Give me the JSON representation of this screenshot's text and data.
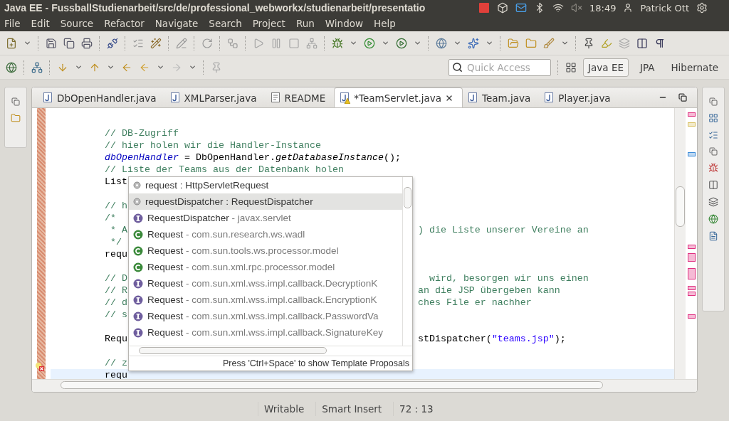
{
  "top_panel": {
    "title": "Java EE - FussballStudienarbeit/src/de/professional_webworkx/studienarbeit/presentatio",
    "time": "18:49",
    "user": "Patrick Ott"
  },
  "menu": [
    "File",
    "Edit",
    "Source",
    "Refactor",
    "Navigate",
    "Search",
    "Project",
    "Run",
    "Window",
    "Help"
  ],
  "quick_access": {
    "placeholder": "Quick Access"
  },
  "perspectives": [
    {
      "label": "Java EE",
      "selected": true
    },
    {
      "label": "JPA",
      "selected": false
    },
    {
      "label": "Hibernate",
      "selected": false
    }
  ],
  "tabs": [
    {
      "label": "DbOpenHandler.java",
      "kind": "java",
      "warning": false,
      "selected": false
    },
    {
      "label": "XMLParser.java",
      "kind": "java",
      "warning": false,
      "selected": false
    },
    {
      "label": "README",
      "kind": "text",
      "warning": false,
      "selected": false
    },
    {
      "label": "*TeamServlet.java",
      "kind": "java",
      "warning": true,
      "selected": true
    },
    {
      "label": "Team.java",
      "kind": "java",
      "warning": false,
      "selected": false
    },
    {
      "label": "Player.java",
      "kind": "java",
      "warning": false,
      "selected": false
    }
  ],
  "code_lines": [
    {
      "kind": "code",
      "current": false,
      "parts": [
        {
          "text": "// DB-Zugriff",
          "kind": "comment"
        }
      ]
    },
    {
      "kind": "code",
      "current": false,
      "parts": [
        {
          "text": "// hier holen wir die Handler-Instance",
          "kind": "comment"
        }
      ]
    },
    {
      "kind": "code",
      "current": false,
      "parts": [
        {
          "text": "dbOpenHandler",
          "kind": "field"
        },
        {
          "text": " = DbOpenHandler.",
          "kind": "plain"
        },
        {
          "text": "getDatabaseInstance",
          "kind": "static"
        },
        {
          "text": "();",
          "kind": "plain"
        }
      ]
    },
    {
      "kind": "code",
      "current": false,
      "parts": [
        {
          "text": "// Liste der Teams aus der Datenbank holen",
          "kind": "comment"
        }
      ]
    },
    {
      "kind": "code",
      "current": false,
      "parts": [
        {
          "text": "List",
          "kind": "plain"
        }
      ]
    },
    {
      "kind": "blank",
      "current": false
    },
    {
      "kind": "code",
      "current": false,
      "parts": [
        {
          "text": "// h",
          "kind": "comment"
        }
      ]
    },
    {
      "kind": "code",
      "current": false,
      "parts": [
        {
          "text": "/*",
          "kind": "comment"
        }
      ]
    },
    {
      "kind": "code",
      "current": false,
      "parts": [
        {
          "text": " * A",
          "kind": "comment"
        }
      ],
      "right": [
        {
          "text": ") die Liste unserer Vereine an",
          "kind": "comment"
        }
      ]
    },
    {
      "kind": "code",
      "current": false,
      "parts": [
        {
          "text": " */",
          "kind": "comment"
        }
      ]
    },
    {
      "kind": "code",
      "current": false,
      "parts": [
        {
          "text": "requ",
          "kind": "plain"
        }
      ]
    },
    {
      "kind": "blank",
      "current": false
    },
    {
      "kind": "code",
      "current": false,
      "parts": [
        {
          "text": "// D",
          "kind": "comment"
        }
      ],
      "right": [
        {
          "text": "  wird, besorgen wir uns einen",
          "kind": "comment"
        }
      ]
    },
    {
      "kind": "code",
      "current": false,
      "parts": [
        {
          "text": "// R",
          "kind": "comment"
        }
      ],
      "right": [
        {
          "text": "an die JSP übergeben kann",
          "kind": "comment"
        }
      ]
    },
    {
      "kind": "code",
      "current": false,
      "parts": [
        {
          "text": "// d",
          "kind": "comment"
        }
      ],
      "right": [
        {
          "text": "ches File er nachher",
          "kind": "comment"
        }
      ]
    },
    {
      "kind": "code",
      "current": false,
      "parts": [
        {
          "text": "// s",
          "kind": "comment"
        }
      ]
    },
    {
      "kind": "blank",
      "current": false
    },
    {
      "kind": "code",
      "current": false,
      "parts": [
        {
          "text": "Requ",
          "kind": "plain"
        }
      ],
      "right": [
        {
          "text": "stDispatcher(",
          "kind": "plain"
        },
        {
          "text": "\"teams.jsp\"",
          "kind": "string"
        },
        {
          "text": ");",
          "kind": "plain"
        }
      ]
    },
    {
      "kind": "blank",
      "current": false
    },
    {
      "kind": "code",
      "current": false,
      "parts": [
        {
          "text": "// z",
          "kind": "comment"
        }
      ]
    },
    {
      "kind": "code",
      "current": true,
      "parts": [
        {
          "text": "requ",
          "kind": "plain"
        }
      ]
    }
  ],
  "completion": {
    "items": [
      {
        "kind": "field",
        "name": "request",
        "detail": " : HttpServletRequest",
        "selected": false
      },
      {
        "kind": "field",
        "name": "requestDispatcher",
        "detail": " : RequestDispatcher",
        "selected": true
      },
      {
        "kind": "interface",
        "name": "RequestDispatcher",
        "detail": " - javax.servlet",
        "selected": false
      },
      {
        "kind": "class",
        "name": "Request",
        "detail": " - com.sun.research.ws.wadl",
        "selected": false
      },
      {
        "kind": "class",
        "name": "Request",
        "detail": " - com.sun.tools.ws.processor.model",
        "selected": false
      },
      {
        "kind": "class",
        "name": "Request",
        "detail": " - com.sun.xml.rpc.processor.model",
        "selected": false
      },
      {
        "kind": "interface",
        "name": "Request",
        "detail": " - com.sun.xml.wss.impl.callback.DecryptionK",
        "selected": false
      },
      {
        "kind": "interface",
        "name": "Request",
        "detail": " - com.sun.xml.wss.impl.callback.EncryptionK",
        "selected": false
      },
      {
        "kind": "interface",
        "name": "Request",
        "detail": " - com.sun.xml.wss.impl.callback.PasswordVa",
        "selected": false
      },
      {
        "kind": "interface",
        "name": "Request",
        "detail": " - com.sun.xml.wss.impl.callback.SignatureKey",
        "selected": false
      }
    ],
    "footer": "Press 'Ctrl+Space' to show Template Proposals"
  },
  "status_bar": [
    "Writable",
    "Smart Insert",
    "72 : 13"
  ]
}
